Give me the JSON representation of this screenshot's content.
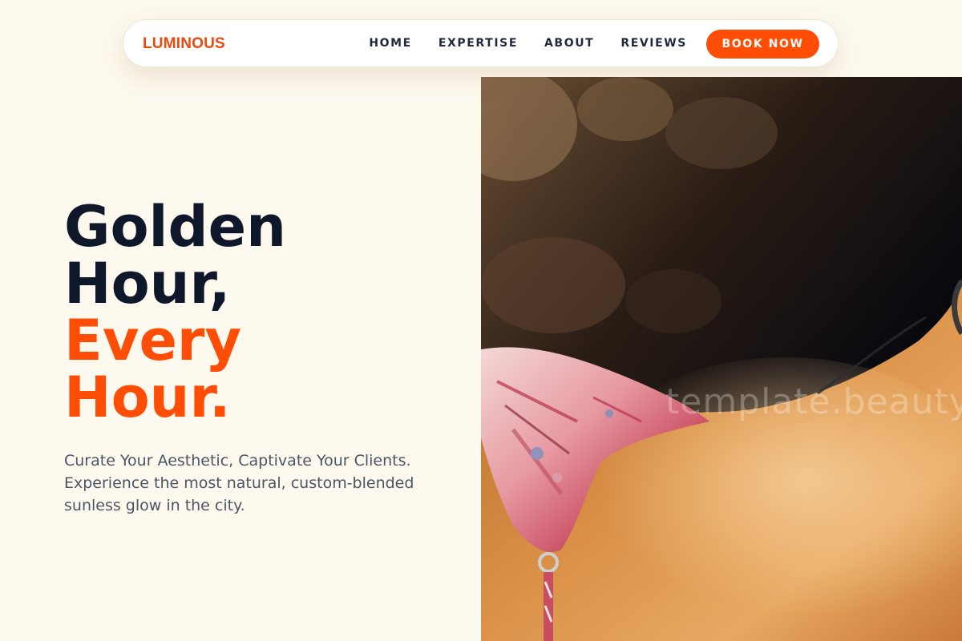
{
  "brand": {
    "name": "LUMINOUS",
    "accent_color": "#ff4d05",
    "background_color": "#fef9ee"
  },
  "nav": {
    "links": [
      {
        "label": "HOME"
      },
      {
        "label": "EXPERTISE"
      },
      {
        "label": "ABOUT"
      },
      {
        "label": "REVIEWS"
      }
    ],
    "cta_label": "BOOK NOW"
  },
  "hero": {
    "headline_line1": "Golden",
    "headline_line2": "Hour,",
    "headline_line3": "Every",
    "headline_line4": "Hour.",
    "subtext": "Curate Your Aesthetic, Captivate Your Clients. Experience the most natural, custom-blended sunless glow in the city.",
    "image_icon": "tanned-shoulder-photo",
    "watermark": "template.beauty"
  }
}
